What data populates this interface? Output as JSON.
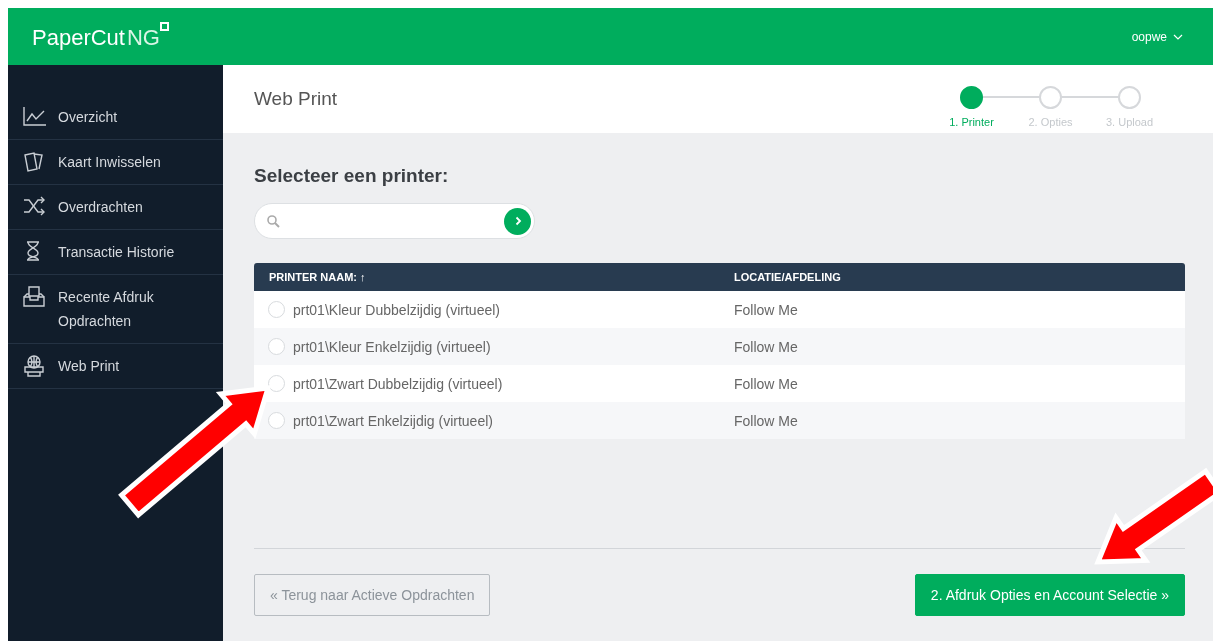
{
  "header": {
    "logo_main": "PaperCut",
    "logo_suffix": "NG",
    "user": "oopwe"
  },
  "sidebar": {
    "items": [
      {
        "label": "Overzicht"
      },
      {
        "label": "Kaart Inwisselen"
      },
      {
        "label": "Overdrachten"
      },
      {
        "label": "Transactie Historie"
      },
      {
        "label": "Recente Afdruk Opdrachten"
      },
      {
        "label": "Web Print"
      }
    ]
  },
  "page": {
    "title": "Web Print"
  },
  "steps": [
    {
      "label": "1. Printer",
      "selected": true
    },
    {
      "label": "2. Opties",
      "selected": false
    },
    {
      "label": "3. Upload",
      "selected": false
    }
  ],
  "heading": "Selecteer een printer:",
  "table": {
    "columns": [
      "PRINTER NAAM:",
      "LOCATIE/AFDELING"
    ],
    "sort_icon": "↑",
    "rows": [
      {
        "printer": "prt01\\Kleur Dubbelzijdig (virtueel)",
        "location": "Follow Me",
        "selected": false
      },
      {
        "printer": "prt01\\Kleur Enkelzijdig (virtueel)",
        "location": "Follow Me",
        "selected": false
      },
      {
        "printer": "prt01\\Zwart Dubbelzijdig (virtueel)",
        "location": "Follow Me",
        "selected": false
      },
      {
        "printer": "prt01\\Zwart Enkelzijdig (virtueel)",
        "location": "Follow Me",
        "selected": false
      }
    ]
  },
  "buttons": {
    "back": "« Terug naar Actieve Opdrachten",
    "next": "2. Afdruk Opties en Account Selectie »"
  },
  "annotations": [
    {
      "kind": "arrow"
    },
    {
      "kind": "arrow"
    }
  ]
}
